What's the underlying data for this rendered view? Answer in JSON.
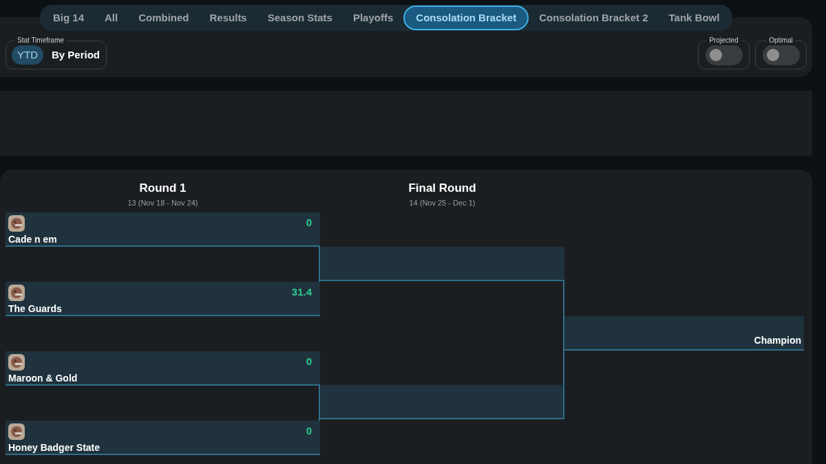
{
  "tabs": [
    {
      "label": "Big 14",
      "selected": false
    },
    {
      "label": "All",
      "selected": false
    },
    {
      "label": "Combined",
      "selected": false
    },
    {
      "label": "Results",
      "selected": false
    },
    {
      "label": "Season Stats",
      "selected": false
    },
    {
      "label": "Playoffs",
      "selected": false
    },
    {
      "label": "Consolation Bracket",
      "selected": true
    },
    {
      "label": "Consolation Bracket 2",
      "selected": false
    },
    {
      "label": "Tank Bowl",
      "selected": false
    }
  ],
  "stat_timeframe": {
    "label": "Stat Timeframe",
    "options": [
      {
        "label": "YTD",
        "selected": true
      },
      {
        "label": "By Period",
        "selected": false
      }
    ]
  },
  "toggles": [
    {
      "label": "Projected",
      "on": false
    },
    {
      "label": "Optimal",
      "on": false
    }
  ],
  "rounds": [
    {
      "title": "Round 1",
      "subtitle": "13 (Nov 18 - Nov 24)"
    },
    {
      "title": "Final Round",
      "subtitle": "14 (Nov 25 - Dec 1)"
    }
  ],
  "matchups": [
    {
      "teams": [
        {
          "name": "Cade n em",
          "score": "0"
        },
        {
          "name": "The Guards",
          "score": "31.4"
        }
      ]
    },
    {
      "teams": [
        {
          "name": "Maroon & Gold",
          "score": "0"
        },
        {
          "name": "Honey Badger State",
          "score": "0"
        }
      ]
    }
  ],
  "champion": {
    "label": "Champion"
  }
}
